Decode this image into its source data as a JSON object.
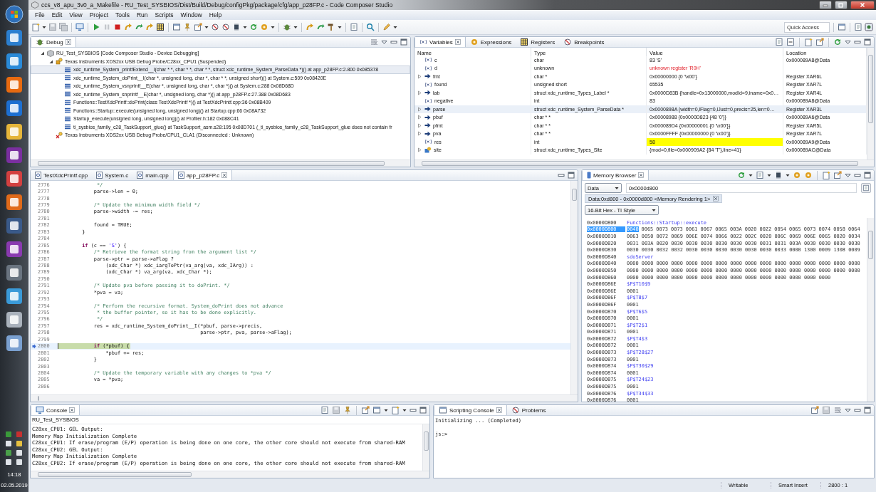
{
  "window": {
    "title": "ccs_v8_apu_3v0_a_Makefile - RU_Test_SYSBIOS/Dist/Build/Debug/configPkg/package/cfg/app_p28FP.c - Code Composer Studio"
  },
  "menu": [
    "File",
    "Edit",
    "View",
    "Project",
    "Tools",
    "Run",
    "Scripts",
    "Window",
    "Help"
  ],
  "quick_access": {
    "placeholder": "Quick Access"
  },
  "taskbar": {
    "time": "14:18",
    "date": "02.05.2019"
  },
  "debug": {
    "tab": "Debug",
    "tree": [
      {
        "kind": "launch",
        "label": "RU_Test_SYSBIOS [Code Composer Studio - Device Debugging]",
        "expanded": true,
        "children": [
          {
            "kind": "target",
            "label": "Texas Instruments XDS2xx USB Debug Probe/C28xx_CPU1 (Suspended)",
            "expanded": true,
            "children": [
              {
                "kind": "frame",
                "label": "xdc_runtime_System_printfExtend__I(char * *, char * *, char * *, struct xdc_runtime_System_ParseData *)() at app_p28FP.c:2.800 0x085378",
                "selected": true
              },
              {
                "kind": "frame",
                "label": "xdc_runtime_System_doPrint__I(char *, unsigned long, char *, char * *, unsigned short)() at System.c:509 0x08420E",
                "selected": false
              },
              {
                "kind": "frame",
                "label": "xdc_runtime_System_vsnprintf__E(char *, unsigned long, char *, char *)() at System.c:288 0x08D68D",
                "selected": false
              },
              {
                "kind": "frame",
                "label": "xdc_runtime_System_snprintf__E(char *, unsigned long, char *)() at app_p28FP.c:27.388 0x08D683",
                "selected": false
              },
              {
                "kind": "frame",
                "label": "Functions::TestXdcPrintf::doPrint(class TestXdcPrintf *)() at TestXdcPrintf.cpp:36 0x08B409",
                "selected": false
              },
              {
                "kind": "frame",
                "label": "Functions::Startup::execute(unsigned long, unsigned long)() at Startup.cpp:66 0x08A732",
                "selected": false
              },
              {
                "kind": "frame",
                "label": "Startup_execute(unsigned long, unsigned long)() at Profiler.h:182 0x088C41",
                "selected": false
              },
              {
                "kind": "frame",
                "label": "ti_sysbios_family_c28_TaskSupport_glue() at TaskSupport_asm.s28:195 0x08D701  (_ti_sysbios_family_c28_TaskSupport_glue does not contain fr",
                "selected": false
              }
            ]
          },
          {
            "kind": "disconnected",
            "label": "Texas Instruments XDS2xx USB Debug Probe/CPU1_CLA1 (Disconnected : Unknown)"
          }
        ]
      }
    ]
  },
  "variables": {
    "tabs": [
      {
        "label": "Variables",
        "selected": true
      },
      {
        "label": "Expressions",
        "selected": false
      },
      {
        "label": "Registers",
        "selected": false
      },
      {
        "label": "Breakpoints",
        "selected": false
      }
    ],
    "columns": [
      "Name",
      "Type",
      "Value",
      "Location"
    ],
    "rows": [
      {
        "kind": "variable",
        "name": "c",
        "type": "char",
        "value": "83 'S'",
        "location": "0x000089A8@Data",
        "selected": false,
        "changed": false,
        "error": false
      },
      {
        "kind": "variable",
        "name": "d",
        "type": "unknown",
        "value": "unknown register 'R0H'",
        "selected": false,
        "changed": false,
        "error": true
      },
      {
        "kind": "pointer",
        "expanded": false,
        "name": "fmt",
        "type": "char *",
        "value": "0x00000000 {0 '\\x00'}",
        "location": "Register XAR6L",
        "selected": false,
        "changed": false,
        "error": false
      },
      {
        "kind": "variable",
        "name": "found",
        "type": "unsigned short",
        "value": "65535",
        "location": "Register XAR7L",
        "selected": false,
        "changed": false,
        "error": false
      },
      {
        "kind": "pointer",
        "expanded": false,
        "name": "lab",
        "type": "struct xdc_runtime_Types_Label *",
        "value": "0x0000D83B {handle=0x13000000,modId=9,iname=0x0…",
        "location": "Register XAR4L",
        "selected": false,
        "changed": false,
        "error": false
      },
      {
        "kind": "variable",
        "name": "negative",
        "type": "int",
        "value": "83",
        "location": "0x000089A8@Data",
        "selected": false,
        "changed": false,
        "error": false
      },
      {
        "kind": "pointer",
        "expanded": false,
        "name": "parse",
        "type": "struct xdc_runtime_System_ParseData *",
        "value": "0x0000898A {width=0,lFlag=0,lJust=0,precis=25,len=0…",
        "location": "Register XAR3L",
        "selected": true,
        "changed": false,
        "error": false
      },
      {
        "kind": "pointer",
        "expanded": false,
        "name": "pbuf",
        "type": "char * *",
        "value": "0x00008988 {0x0000D823 {48 '0'}}",
        "location": "0x000089A6@Data",
        "selected": false,
        "changed": false,
        "error": false
      },
      {
        "kind": "pointer",
        "expanded": false,
        "name": "pfmt",
        "type": "char * *",
        "value": "0x000089D4 {0x00000001 {0 '\\x00'}}",
        "location": "Register XAR5L",
        "selected": false,
        "changed": false,
        "error": false
      },
      {
        "kind": "pointer",
        "expanded": false,
        "name": "pva",
        "type": "char * *",
        "value": "0x0000FFFF {0x00000000 {0 '\\x00'}}",
        "location": "Register XAR7L",
        "selected": false,
        "changed": false,
        "error": false
      },
      {
        "kind": "variable",
        "name": "res",
        "type": "int",
        "value": "58",
        "location": "0x000089A9@Data",
        "selected": false,
        "changed": true,
        "error": false
      },
      {
        "kind": "struct",
        "expanded": false,
        "name": "site",
        "type": "struct xdc_runtime_Types_Site",
        "value": "{mod=0,file=0x000909A2 {84 'T'},line=41}",
        "location": "0x000089AC@Data",
        "selected": false,
        "changed": false,
        "error": false
      }
    ]
  },
  "editor": {
    "tabs": [
      {
        "label": "TestXdcPrintf.cpp",
        "selected": false
      },
      {
        "label": "System.c",
        "selected": false
      },
      {
        "label": "main.cpp",
        "selected": false
      },
      {
        "label": "app_p28FP.c",
        "selected": true
      }
    ],
    "lines": [
      {
        "number": "2776",
        "current": false,
        "segments": [
          {
            "kind": "comment",
            "text": "             */"
          }
        ]
      },
      {
        "number": "2777",
        "current": false,
        "segments": [
          {
            "kind": "code",
            "text": "            parse->len = 0;"
          }
        ]
      },
      {
        "number": "2778",
        "current": false
      },
      {
        "number": "2779",
        "current": false,
        "segments": [
          {
            "kind": "comment",
            "text": "            /* Update the minimum width field */"
          }
        ]
      },
      {
        "number": "2780",
        "current": false,
        "segments": [
          {
            "kind": "code",
            "text": "            parse->width -= res;"
          }
        ]
      },
      {
        "number": "2781",
        "current": false
      },
      {
        "number": "2782",
        "current": false,
        "segments": [
          {
            "kind": "code",
            "text": "            found = TRUE;"
          }
        ]
      },
      {
        "number": "2783",
        "current": false,
        "segments": [
          {
            "kind": "code",
            "text": "        }"
          }
        ]
      },
      {
        "number": "2784",
        "current": false
      },
      {
        "number": "2785",
        "current": false,
        "segments": [
          {
            "kind": "keyword",
            "text": "        if"
          },
          {
            "kind": "code",
            "text": " (c == "
          },
          {
            "kind": "string",
            "text": "'S'"
          },
          {
            "kind": "code",
            "text": ") {"
          }
        ]
      },
      {
        "number": "2786",
        "current": false,
        "segments": [
          {
            "kind": "comment",
            "text": "            /* Retrieve the format string from the argument list */"
          }
        ]
      },
      {
        "number": "2787",
        "current": false,
        "segments": [
          {
            "kind": "code",
            "text": "            parse->ptr = parse->aFlag ?"
          }
        ]
      },
      {
        "number": "2788",
        "current": false,
        "segments": [
          {
            "kind": "code",
            "text": "                (xdc_Char *) xdc_iargToPtr(va_arg(va, xdc_IArg)) :"
          }
        ]
      },
      {
        "number": "2789",
        "current": false,
        "segments": [
          {
            "kind": "code",
            "text": "                (xdc_Char *) va_arg(va, xdc_Char *);"
          }
        ]
      },
      {
        "number": "2790",
        "current": false
      },
      {
        "number": "2791",
        "current": false,
        "segments": [
          {
            "kind": "comment",
            "text": "            /* Update pva before passing it to doPrint. */"
          }
        ]
      },
      {
        "number": "2792",
        "current": false,
        "segments": [
          {
            "kind": "code",
            "text": "            *pva = va;"
          }
        ]
      },
      {
        "number": "2793",
        "current": false
      },
      {
        "number": "2794",
        "current": false,
        "segments": [
          {
            "kind": "comment",
            "text": "            /* Perform the recursive format. System_doPrint does not advance"
          }
        ]
      },
      {
        "number": "2795",
        "current": false,
        "segments": [
          {
            "kind": "comment",
            "text": "             * the buffer pointer, so it has to be done explicitly."
          }
        ]
      },
      {
        "number": "2796",
        "current": false,
        "segments": [
          {
            "kind": "comment",
            "text": "             */"
          }
        ]
      },
      {
        "number": "2797",
        "current": false,
        "segments": [
          {
            "kind": "code",
            "text": "            res = xdc_runtime_System_doPrint__I(*pbuf, parse->precis,"
          }
        ]
      },
      {
        "number": "2798",
        "current": false,
        "segments": [
          {
            "kind": "code",
            "text": "                                                parse->ptr, pva, parse->aFlag);"
          }
        ]
      },
      {
        "number": "2799",
        "current": false
      },
      {
        "number": "2800",
        "current": true,
        "segments": [
          {
            "kind": "keyword",
            "text": "            if"
          },
          {
            "kind": "code",
            "text": " (*pbuf) {"
          }
        ]
      },
      {
        "number": "2801",
        "current": false,
        "segments": [
          {
            "kind": "code",
            "text": "                *pbuf += res;"
          }
        ]
      },
      {
        "number": "2802",
        "current": false,
        "segments": [
          {
            "kind": "code",
            "text": "            }"
          }
        ]
      },
      {
        "number": "2803",
        "current": false
      },
      {
        "number": "2804",
        "current": false,
        "segments": [
          {
            "kind": "comment",
            "text": "            /* Update the temporary variable with any changes to *pva */"
          }
        ]
      },
      {
        "number": "2805",
        "current": false,
        "segments": [
          {
            "kind": "code",
            "text": "            va = *pva;"
          }
        ]
      },
      {
        "number": "2806",
        "current": false
      }
    ]
  },
  "memory": {
    "tab": "Memory Browser",
    "space": "Data",
    "address": "0x0000d800",
    "rendering_tab": "Data:0xd800 - 0x0000d800 <Memory Rendering 1>",
    "format": "16-Bit Hex - TI Style",
    "rows": [
      {
        "address": "0x0000D800",
        "kind": "label",
        "text": "Functions::Startup::execute",
        "selected": false
      },
      {
        "address": "0x0000D800",
        "kind": "data",
        "cursor": "0040",
        "text": "0065 0073 0073 0061 0067 0065 003A 0020 0022 0054 0065 0073 0074 0058 0064",
        "selected": true
      },
      {
        "address": "0x0000D810",
        "kind": "data",
        "text": "0063 0050 0072 0069 006E 0074 0066 0022 002C 0020 006C 0069 006E 0065 0020 0034",
        "selected": false
      },
      {
        "address": "0x0000D820",
        "kind": "data",
        "text": "0031 003A 0020 0030 0030 0030 0030 0030 0030 0031 0031 003A 0030 0030 0030 0030",
        "selected": false
      },
      {
        "address": "0x0000D830",
        "kind": "data",
        "text": "0030 0030 0032 0032 0030 0030 0030 0030 0030 0030 0033 0000 1300 0009 1308 0009",
        "selected": false
      },
      {
        "address": "0x0000D840",
        "kind": "label",
        "text": "sdoServer",
        "selected": false
      },
      {
        "address": "0x0000D840",
        "kind": "data",
        "text": "0000 0000 0000 0000 0000 0000 0000 0000 0000 0000 0000 0000 0000 0000 0000 0000",
        "selected": false
      },
      {
        "address": "0x0000D850",
        "kind": "data",
        "text": "0000 0000 0000 0000 0000 0000 0000 0000 0000 0000 0000 0000 0000 0000 0000 0000",
        "selected": false
      },
      {
        "address": "0x0000D860",
        "kind": "data",
        "text": "0000 0000 0000 0000 0000 0000 0000 0000 0000 0000 0000 0000 0000 0000",
        "selected": false
      },
      {
        "address": "0x0000D86E",
        "kind": "label",
        "text": "$P$T10$9",
        "selected": false
      },
      {
        "address": "0x0000D86E",
        "kind": "data",
        "text": "0001",
        "selected": false
      },
      {
        "address": "0x0000D86F",
        "kind": "label",
        "text": "$P$T8$7",
        "selected": false
      },
      {
        "address": "0x0000D86F",
        "kind": "data",
        "text": "0001",
        "selected": false
      },
      {
        "address": "0x0000D870",
        "kind": "label",
        "text": "$P$T6$5",
        "selected": false
      },
      {
        "address": "0x0000D870",
        "kind": "data",
        "text": "0001",
        "selected": false
      },
      {
        "address": "0x0000D871",
        "kind": "label",
        "text": "$P$T2$1",
        "selected": false
      },
      {
        "address": "0x0000D871",
        "kind": "data",
        "text": "0001",
        "selected": false
      },
      {
        "address": "0x0000D872",
        "kind": "label",
        "text": "$P$T4$3",
        "selected": false
      },
      {
        "address": "0x0000D872",
        "kind": "data",
        "text": "0001",
        "selected": false
      },
      {
        "address": "0x0000D873",
        "kind": "label",
        "text": "$P$T28$27",
        "selected": false
      },
      {
        "address": "0x0000D873",
        "kind": "data",
        "text": "0001",
        "selected": false
      },
      {
        "address": "0x0000D874",
        "kind": "label",
        "text": "$P$T30$29",
        "selected": false
      },
      {
        "address": "0x0000D874",
        "kind": "data",
        "text": "0001",
        "selected": false
      },
      {
        "address": "0x0000D875",
        "kind": "label",
        "text": "$P$T24$23",
        "selected": false
      },
      {
        "address": "0x0000D875",
        "kind": "data",
        "text": "0001",
        "selected": false
      },
      {
        "address": "0x0000D876",
        "kind": "label",
        "text": "$P$T34$33",
        "selected": false
      },
      {
        "address": "0x0000D876",
        "kind": "data",
        "text": "0001",
        "selected": false
      }
    ]
  },
  "console": {
    "tab": "Console",
    "source": "RU_Test_SYSBIOS",
    "lines": [
      "C28xx_CPU1: GEL Output:",
      "Memory Map Initialization Complete",
      "C28xx_CPU1: If erase/program (E/P) operation is being done on one core, the other core should not execute from shared-RAM",
      "C28xx_CPU2: GEL Output:",
      "Memory Map Initialization Complete",
      "C28xx_CPU2: If erase/program (E/P) operation is being done on one core, the other core should not execute from shared-RAM"
    ]
  },
  "scripting": {
    "tabs": [
      {
        "label": "Scripting Console",
        "selected": true
      },
      {
        "label": "Problems",
        "selected": false
      }
    ],
    "lines": [
      "Initializing ... (Completed)"
    ],
    "prompt": "js:>"
  },
  "status_bar": [
    "Writable",
    "Smart Insert",
    "2800 : 1"
  ]
}
